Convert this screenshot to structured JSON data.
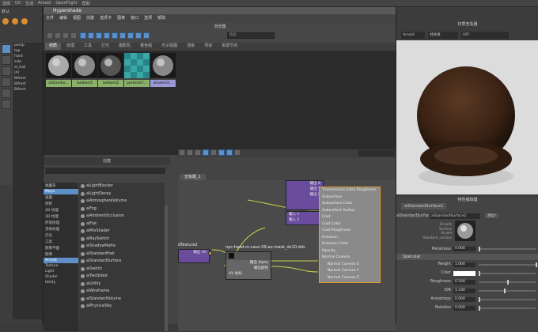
{
  "app": {
    "top_menu": [
      "选择",
      "",
      "",
      "",
      "",
      "",
      "",
      "",
      "UV",
      "生成",
      "Arnold",
      "OpenFlight",
      "帮助"
    ],
    "left_panels": [
      "默认",
      "显示"
    ],
    "outliner_items": [
      "persp",
      "top",
      "front",
      "side",
      "ai_hair",
      "UV",
      "Bifrost",
      "Bifrost",
      "Bifrost"
    ]
  },
  "hypershade": {
    "title": "Hypershade",
    "menu": [
      "文件",
      "编辑",
      "视图",
      "创建",
      "选项卡",
      "图表",
      "窗口",
      "选项",
      "帮助"
    ],
    "browser_label": "浏览器",
    "search_placeholder": "搜索",
    "tabs": [
      "材质",
      "纹理",
      "工具",
      "灯光",
      "摄影机",
      "着色组",
      "光子贴图",
      "渲染",
      "项目",
      "资源节点"
    ],
    "materials": [
      {
        "name": "aiStandar..."
      },
      {
        "name": "lambert1"
      },
      {
        "name": "lambert2"
      },
      {
        "name": "particleCl..."
      },
      {
        "name": "shaderGl..."
      }
    ],
    "create_label": "创建",
    "create_tree": [
      "收藏夹",
      "Maya",
      "表面",
      "体积",
      "2D 纹理",
      "3D 纹理",
      "环境纹理",
      "其他纹理",
      "灯光",
      "工具",
      "图像平面",
      "照明",
      "Arnold",
      "Texture",
      "Light",
      "Shader",
      "Utility"
    ],
    "create_list": [
      "aiLightBlocker",
      "aiLightDecay",
      "aiAtmosphereVolume",
      "aiFog",
      "aiAmbientOcclusion",
      "aiFlat",
      "aiMixShader",
      "aiRaySwitch",
      "aiShadowMatte",
      "aiStandardHair",
      "aiStandardSurface",
      "aiSwitch",
      "aiTwoSided",
      "aiUtility",
      "aiWireframe",
      "aiStandardVolume",
      "aiPhysicalSky"
    ],
    "graph_tab": "无标题_1",
    "graph_nodes": {
      "file_node_label": "npc-head-m-cauc-09-ao-mask_dx10.dds",
      "file_outputs": [
        "输出 Alpha",
        "输出颜色"
      ],
      "uv_label": "UV 坐标",
      "place_label": "dTexture2",
      "place_out": "输出 UV",
      "layer_inputs": [
        "输出 X",
        "输出 Y",
        "输出 Z",
        "输入 1",
        "输入 2"
      ],
      "shader_ports": [
        "Transmission Extra Roughness",
        "Subsurface",
        "Subsurface Color",
        "Subsurface Radius",
        "Coat",
        "Coat Color",
        "Coat Roughness",
        "Emission",
        "Emission Color",
        "Opacity",
        "Normal Camera",
        "Normal Camera X",
        "Normal Camera Y",
        "Normal Camera Z"
      ]
    }
  },
  "material_viewer": {
    "title": "材质查看器",
    "renderer": "Arnold",
    "shape": "材质球",
    "mode": "OFF"
  },
  "attr_editor": {
    "title": "特性编辑器",
    "tab": "aiStandardSurface1",
    "type_label": "aiStandardSurface:",
    "node_name": "aiStandardSurface1",
    "presets": "预设*",
    "swatch_caption": [
      "Dreads",
      "Surface",
      "Arnold",
      "Standard_surface"
    ],
    "metalness_label": "Metalness",
    "metalness": "0.000",
    "section": "Specular",
    "fields": [
      {
        "label": "Weight",
        "value": "1.000",
        "pos": 1.0
      },
      {
        "label": "Color",
        "value": "",
        "pos": 0
      },
      {
        "label": "Roughness",
        "value": "0.500",
        "pos": 0.5
      },
      {
        "label": "IOR",
        "value": "1.330",
        "pos": 0.45
      },
      {
        "label": "Anisotropy",
        "value": "0.000",
        "pos": 0
      },
      {
        "label": "Rotation",
        "value": "0.000",
        "pos": 0
      }
    ]
  }
}
